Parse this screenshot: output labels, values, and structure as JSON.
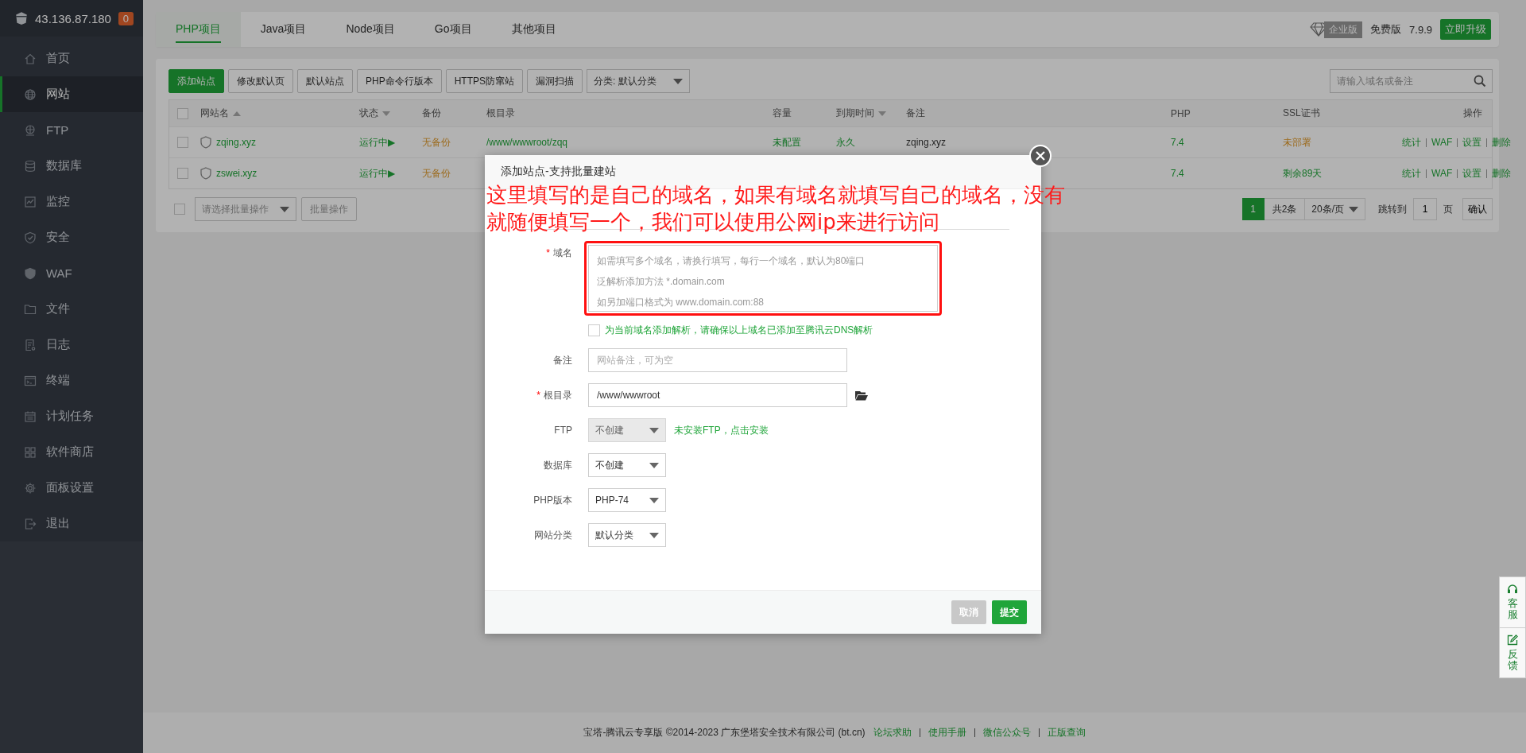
{
  "sidebar": {
    "server_ip": "43.136.87.180",
    "badge": "0",
    "items": [
      {
        "label": "首页",
        "selected": false
      },
      {
        "label": "网站",
        "selected": true
      },
      {
        "label": "FTP",
        "selected": false
      },
      {
        "label": "数据库",
        "selected": false
      },
      {
        "label": "监控",
        "selected": false
      },
      {
        "label": "安全",
        "selected": false
      },
      {
        "label": "WAF",
        "selected": false
      },
      {
        "label": "文件",
        "selected": false
      },
      {
        "label": "日志",
        "selected": false
      },
      {
        "label": "终端",
        "selected": false
      },
      {
        "label": "计划任务",
        "selected": false
      },
      {
        "label": "软件商店",
        "selected": false
      },
      {
        "label": "面板设置",
        "selected": false
      },
      {
        "label": "退出",
        "selected": false
      }
    ]
  },
  "project_tabs": [
    {
      "label": "PHP项目",
      "selected": true
    },
    {
      "label": "Java项目",
      "selected": false
    },
    {
      "label": "Node项目",
      "selected": false
    },
    {
      "label": "Go项目",
      "selected": false
    },
    {
      "label": "其他项目",
      "selected": false
    }
  ],
  "edition": {
    "badge": "企业版",
    "plan": "免费版",
    "version": "7.9.9",
    "upgrade_button": "立即升级"
  },
  "toolbar": {
    "buttons": [
      {
        "label": "添加站点",
        "kind": "primary"
      },
      {
        "label": "修改默认页",
        "kind": "plain"
      },
      {
        "label": "默认站点",
        "kind": "plain"
      },
      {
        "label": "PHP命令行版本",
        "kind": "plain"
      },
      {
        "label": "HTTPS防窜站",
        "kind": "plain"
      },
      {
        "label": "漏洞扫描",
        "kind": "plain"
      }
    ],
    "category_select": "分类: 默认分类",
    "search": {
      "placeholder": "请输入域名或备注"
    }
  },
  "table": {
    "all_checked": false,
    "columns": [
      {
        "label": "网站名",
        "sortable": true,
        "ascending": true
      },
      {
        "label": "状态",
        "sortable": true,
        "ascending": false
      },
      {
        "label": "备份",
        "sortable": false
      },
      {
        "label": "根目录",
        "sortable": false
      },
      {
        "label": "容量",
        "sortable": false
      },
      {
        "label": "到期时间",
        "sortable": true,
        "ascending": false
      },
      {
        "label": "备注",
        "sortable": false
      },
      {
        "label": "PHP",
        "sortable": false
      },
      {
        "label": "SSL证书",
        "sortable": false
      },
      {
        "label": "操作",
        "sortable": false
      }
    ],
    "rows": [
      {
        "checked": false,
        "name": "zqing.xyz",
        "status": "运行中▶",
        "backup": "无备份",
        "root": "/www/wwwroot/zqq",
        "capacity": "未配置",
        "expiry": "永久",
        "note": "zqing.xyz",
        "php": "7.4",
        "ssl": {
          "text": "未部署",
          "kind": "warning"
        },
        "actions": [
          "统计",
          "WAF",
          "设置",
          "删除"
        ]
      },
      {
        "checked": false,
        "name": "zswei.xyz",
        "status": "运行中▶",
        "backup": "无备份",
        "php": "7.4",
        "ssl": {
          "text": "剩余89天",
          "kind": "ok"
        },
        "actions": [
          "统计",
          "WAF",
          "设置",
          "删除"
        ]
      }
    ]
  },
  "batch": {
    "checked": false,
    "select_placeholder": "请选择批量操作",
    "button": "批量操作"
  },
  "pagination": {
    "pages": [
      {
        "label": "1",
        "selected": true
      }
    ],
    "total": "共2条",
    "page_size": "20条/页",
    "jump_label": "跳转到",
    "jump_value": "1",
    "page_unit": "页",
    "confirm": "确认"
  },
  "dialog": {
    "title": "添加站点-支持批量建站",
    "fields": [
      {
        "kind": "textarea",
        "label": "域名",
        "required_mark": "*",
        "highlighted": true,
        "placeholder_lines": [
          "如需填写多个域名，请换行填写，每行一个域名，默认为80端口",
          "泛解析添加方法 *.domain.com",
          "如另加端口格式为 www.domain.com:88"
        ]
      },
      {
        "kind": "checkbox",
        "label": "为当前域名添加解析，请确保以上域名已添加至腾讯云DNS解析",
        "checked": false
      },
      {
        "kind": "input",
        "label": "备注",
        "placeholder": "网站备注，可为空"
      },
      {
        "kind": "input",
        "label": "根目录",
        "required_mark": "*",
        "value": "/www/wwwroot",
        "folder_button": true
      },
      {
        "kind": "select",
        "label": "FTP",
        "value": "不创建",
        "disabled": true,
        "note": "未安装FTP，点击安装"
      },
      {
        "kind": "select",
        "label": "数据库",
        "value": "不创建",
        "disabled": false
      },
      {
        "kind": "select",
        "label": "PHP版本",
        "value": "PHP-74",
        "disabled": false
      },
      {
        "kind": "select",
        "label": "网站分类",
        "value": "默认分类",
        "disabled": false
      }
    ],
    "buttons": [
      {
        "label": "取消",
        "kind": "secondary"
      },
      {
        "label": "提交",
        "kind": "primary"
      }
    ]
  },
  "annotation": {
    "lines": [
      "这里填写的是自己的域名，如果有域名就填写自己的域名，没有",
      "就随便填写一个，我们可以使用公网ip来进行访问"
    ]
  },
  "footer": {
    "copyright": "宝塔-腾讯云专享版 ©2014-2023 广东堡塔安全技术有限公司 (bt.cn)",
    "links": [
      "论坛求助",
      "使用手册",
      "微信公众号",
      "正版查询"
    ]
  },
  "float_buttons": [
    {
      "label": "客服"
    },
    {
      "label": "反馈"
    }
  ]
}
